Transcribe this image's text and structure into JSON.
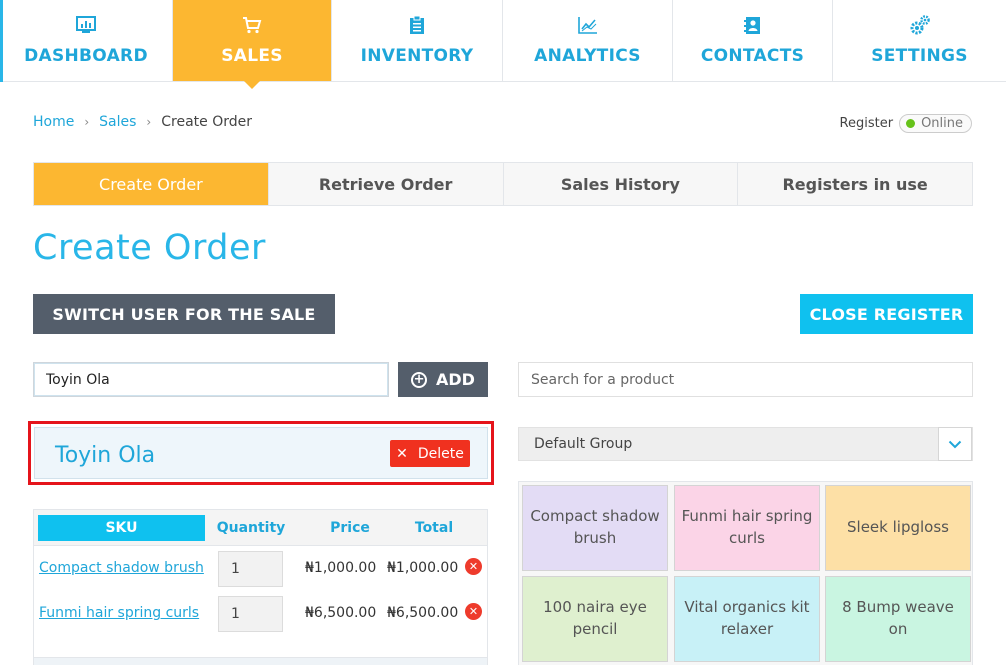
{
  "nav": {
    "tabs": [
      {
        "label": "DASHBOARD",
        "icon": "dashboard-chart-icon",
        "active": false
      },
      {
        "label": "SALES",
        "icon": "cart-icon",
        "active": true
      },
      {
        "label": "INVENTORY",
        "icon": "clipboard-icon",
        "active": false
      },
      {
        "label": "ANALYTICS",
        "icon": "line-chart-icon",
        "active": false
      },
      {
        "label": "CONTACTS",
        "icon": "address-book-icon",
        "active": false
      },
      {
        "label": "SETTINGS",
        "icon": "gears-icon",
        "active": false
      }
    ]
  },
  "breadcrumb": {
    "home": "Home",
    "sales": "Sales",
    "current": "Create Order"
  },
  "register": {
    "label": "Register",
    "status": "Online",
    "status_color": "#66c21a"
  },
  "subtabs": [
    "Create Order",
    "Retrieve Order",
    "Sales History",
    "Registers in use"
  ],
  "page_title": "Create Order",
  "buttons": {
    "switch_user": "SWITCH USER FOR THE SALE",
    "close_register": "CLOSE REGISTER",
    "add": "ADD",
    "delete": "Delete"
  },
  "customer": {
    "input_value": "Toyin Ola",
    "selected_name": "Toyin Ola"
  },
  "order_table": {
    "headers": {
      "sku": "SKU",
      "quantity": "Quantity",
      "price": "Price",
      "total": "Total"
    },
    "rows": [
      {
        "sku": "Compact shadow brush",
        "quantity": "1",
        "price": "₦1,000.00",
        "total": "₦1,000.00"
      },
      {
        "sku": "Funmi hair spring curls",
        "quantity": "1",
        "price": "₦6,500.00",
        "total": "₦6,500.00"
      }
    ]
  },
  "product_search": {
    "placeholder": "Search for a product"
  },
  "group_select": {
    "value": "Default Group"
  },
  "products": [
    {
      "name": "Compact shadow brush",
      "color": "#e3dcf5"
    },
    {
      "name": "Funmi hair spring curls",
      "color": "#fbd4e7"
    },
    {
      "name": "Sleek lipgloss",
      "color": "#fde0a6"
    },
    {
      "name": "100 naira eye pencil",
      "color": "#dff0cf"
    },
    {
      "name": "Vital organics kit relaxer",
      "color": "#c8f1f7"
    },
    {
      "name": "8 Bump weave on",
      "color": "#c9f5e1"
    }
  ],
  "colors": {
    "accent_orange": "#fcb731",
    "accent_blue": "#29b6e8",
    "cyan_button": "#0fc1ef",
    "dark_button": "#545e6b",
    "delete_red": "#f0311f"
  }
}
